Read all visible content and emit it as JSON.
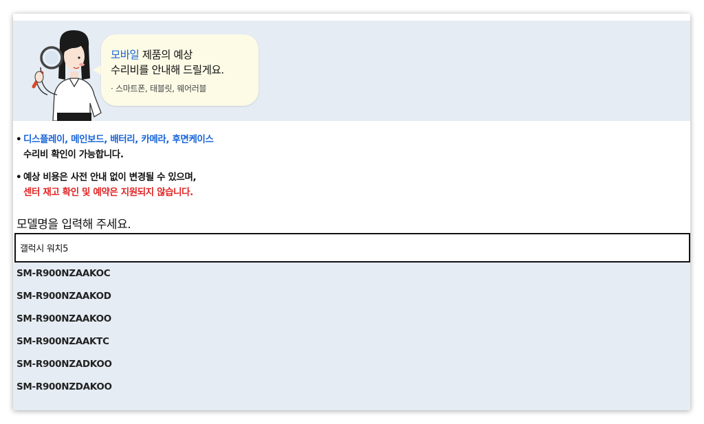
{
  "banner": {
    "highlight": "모바일",
    "line1_rest": " 제품의 예상",
    "line2": "수리비를 안내해 드릴게요.",
    "sub": "· 스마트폰, 태블릿, 웨어러블"
  },
  "notes": {
    "n1_blue": "디스플레이, 메인보드, 배터리, 카메라, 후면케이스",
    "n1_black": "수리비 확인이 가능합니다.",
    "n2_black": "예상 비용은 사전 안내 없이 변경될 수 있으며,",
    "n2_red": "센터 재고 확인 및 예약은 지원되지 않습니다.",
    "bullet": "•"
  },
  "model_title": "모델명을 입력해 주세요.",
  "search": {
    "value": "갤럭시 워치5"
  },
  "results": [
    "SM-R900NZAAKOC",
    "SM-R900NZAAKOD",
    "SM-R900NZAAKOO",
    "SM-R900NZAAKTC",
    "SM-R900NZADKOO",
    "SM-R900NZDAKOO"
  ],
  "colors": {
    "accent_blue": "#1763d9",
    "warning_red": "#e02424",
    "banner_bg": "#e5ecf4",
    "bubble_bg": "#fdfbe6"
  },
  "icons": {
    "character": "woman-with-magnifier-illustration"
  }
}
